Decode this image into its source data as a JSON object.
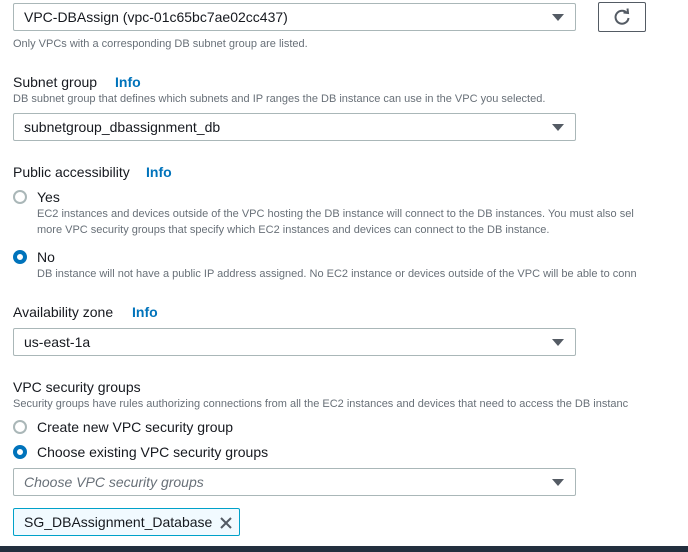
{
  "vpc": {
    "selected": "VPC-DBAssign (vpc-01c65bc7ae02cc437)",
    "description": "Only VPCs with a corresponding DB subnet group are listed.",
    "refresh_icon": "refresh-icon"
  },
  "subnet_group": {
    "label": "Subnet group",
    "info": "Info",
    "description": "DB subnet group that defines which subnets and IP ranges the DB instance can use in the VPC you selected.",
    "selected": "subnetgroup_dbassignment_db"
  },
  "public_access": {
    "label": "Public accessibility",
    "info": "Info",
    "options": [
      {
        "label": "Yes",
        "desc_line1": "EC2 instances and devices outside of the VPC hosting the DB instance will connect to the DB instances. You must also sel",
        "desc_line2": "more VPC security groups that specify which EC2 instances and devices can connect to the DB instance.",
        "checked": false
      },
      {
        "label": "No",
        "desc_line1": "DB instance will not have a public IP address assigned. No EC2 instance or devices outside of the VPC will be able to conn",
        "checked": true
      }
    ]
  },
  "availability_zone": {
    "label": "Availability zone",
    "info": "Info",
    "selected": "us-east-1a"
  },
  "security_groups": {
    "label": "VPC security groups",
    "description": "Security groups have rules authorizing connections from all the EC2 instances and devices that need to access the DB instanc",
    "options": [
      {
        "label": "Create new VPC security group",
        "checked": false
      },
      {
        "label": "Choose existing VPC security groups",
        "checked": true
      }
    ],
    "placeholder": "Choose VPC security groups",
    "tokens": [
      {
        "label": "SG_DBAssignment_Database"
      }
    ]
  },
  "colors": {
    "accent": "#0073bb",
    "token_bg": "#f1faff",
    "token_border": "#00a1c9"
  }
}
